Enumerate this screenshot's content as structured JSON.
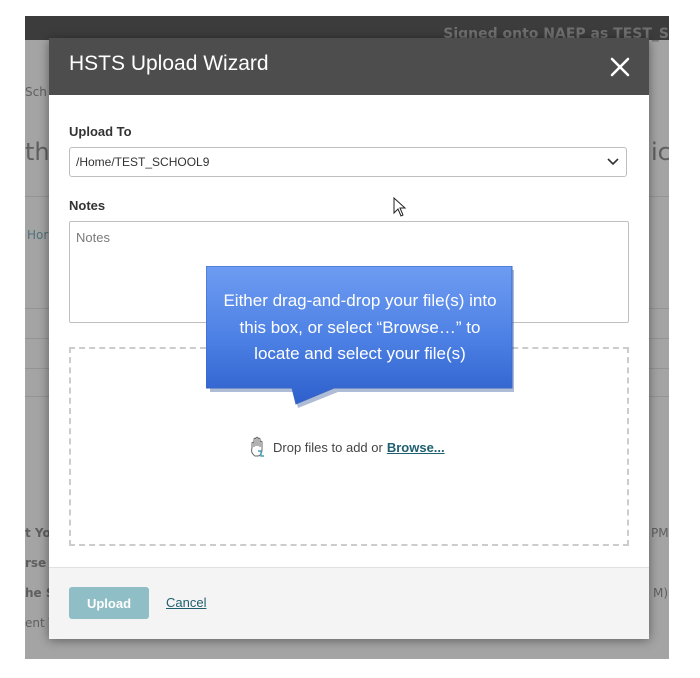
{
  "background_page": {
    "signed_in_text": "Signed onto NAEP as TEST_S",
    "fragments": [
      "Sch",
      "thi",
      "ic",
      "Hor",
      "t Yo",
      "rse",
      "he S",
      "ent T",
      "PM)",
      "M)"
    ]
  },
  "dialog": {
    "title": "HSTS Upload Wizard",
    "upload_to": {
      "label": "Upload To",
      "selected": "/Home/TEST_SCHOOL9"
    },
    "notes": {
      "label": "Notes",
      "placeholder": "Notes",
      "value": ""
    },
    "drop_zone": {
      "text": "Drop files to add or",
      "browse_label": "Browse..."
    },
    "footer": {
      "upload_label": "Upload",
      "cancel_label": "Cancel"
    }
  },
  "callout": {
    "lines": [
      "Either drag-and-drop your file(s) into",
      "this box, or select “Browse…” to",
      "locate and select your file(s)"
    ]
  },
  "colors": {
    "header": "#4d4d4d",
    "upload_button": "#8fbec6",
    "link": "#1f5f70",
    "callout": "#4a7be0"
  },
  "icons": [
    "close-icon",
    "chevron-down-icon",
    "drop-files-icon",
    "mouse-cursor"
  ]
}
